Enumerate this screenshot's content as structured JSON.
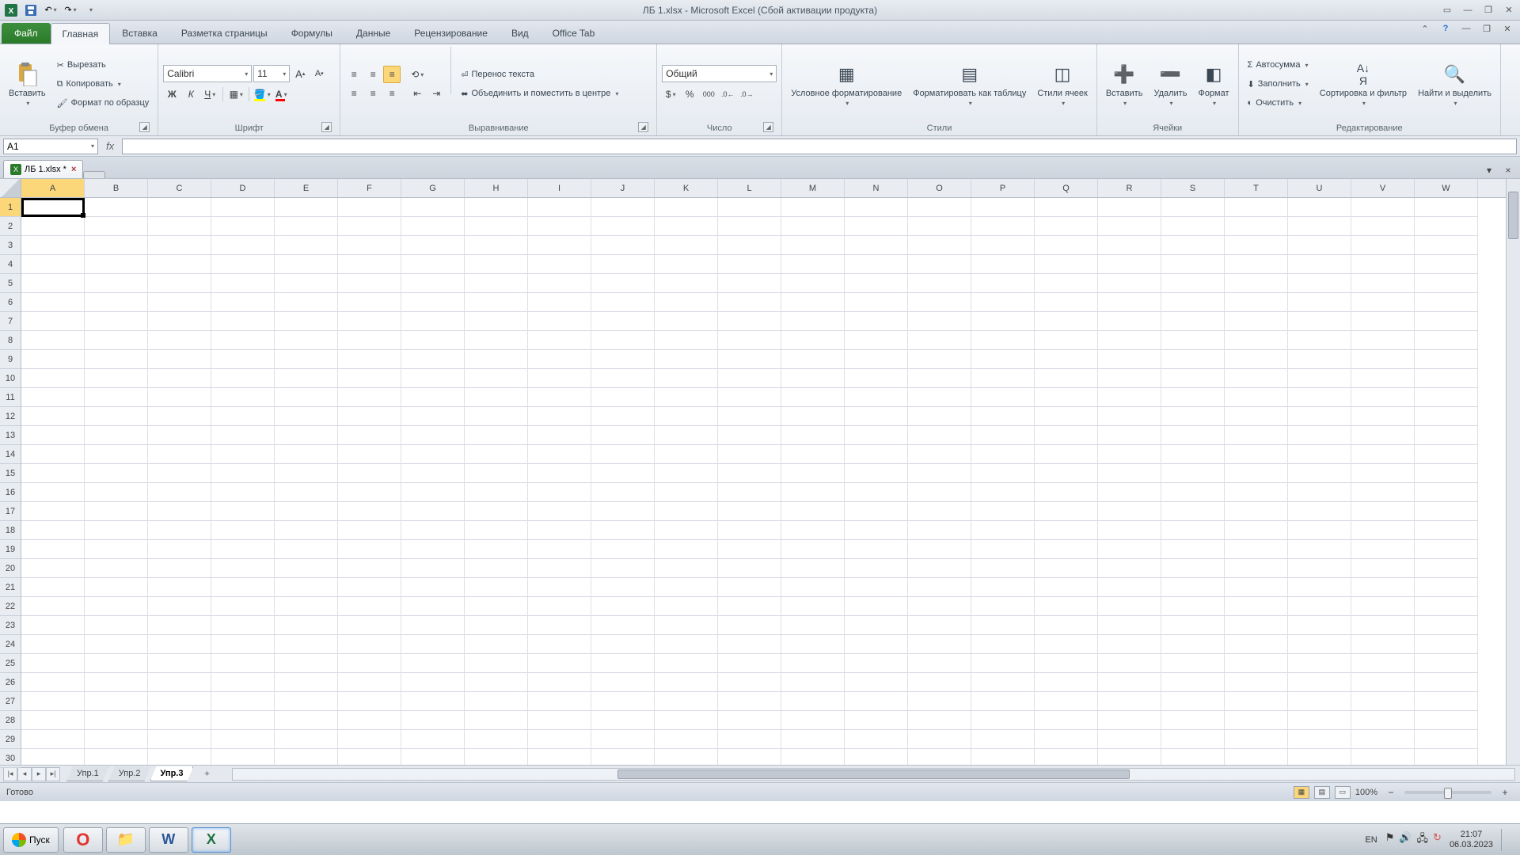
{
  "title": "ЛБ 1.xlsx - Microsoft Excel (Сбой активации продукта)",
  "qat": {
    "undo": "↶",
    "redo": "↷"
  },
  "tabs": {
    "file": "Файл",
    "items": [
      "Главная",
      "Вставка",
      "Разметка страницы",
      "Формулы",
      "Данные",
      "Рецензирование",
      "Вид",
      "Office Tab"
    ],
    "active": 0
  },
  "ribbon": {
    "clipboard": {
      "paste": "Вставить",
      "cut": "Вырезать",
      "copy": "Копировать",
      "format": "Формат по образцу",
      "title": "Буфер обмена"
    },
    "font": {
      "name": "Calibri",
      "size": "11",
      "title": "Шрифт"
    },
    "align": {
      "wrap": "Перенос текста",
      "merge": "Объединить и поместить в центре",
      "title": "Выравнивание"
    },
    "number": {
      "format": "Общий",
      "title": "Число"
    },
    "styles": {
      "cond": "Условное форматирование",
      "table": "Форматировать как таблицу",
      "cell": "Стили ячеек",
      "title": "Стили"
    },
    "cells": {
      "insert": "Вставить",
      "delete": "Удалить",
      "format": "Формат",
      "title": "Ячейки"
    },
    "editing": {
      "sum": "Автосумма",
      "fill": "Заполнить",
      "clear": "Очистить",
      "sort": "Сортировка и фильтр",
      "find": "Найти и выделить",
      "title": "Редактирование"
    }
  },
  "namebox": "A1",
  "doc_tab": {
    "name": "ЛБ 1.xlsx *"
  },
  "columns": [
    "A",
    "B",
    "C",
    "D",
    "E",
    "F",
    "G",
    "H",
    "I",
    "J",
    "K",
    "L",
    "M",
    "N",
    "O",
    "P",
    "Q",
    "R",
    "S",
    "T",
    "U",
    "V",
    "W"
  ],
  "rows": 30,
  "sheets": {
    "items": [
      "Упр.1",
      "Упр.2",
      "Упр.3"
    ],
    "active": 2
  },
  "status": {
    "ready": "Готово",
    "zoom": "100%"
  },
  "taskbar": {
    "start": "Пуск",
    "lang": "EN",
    "time": "21:07",
    "date": "06.03.2023"
  }
}
